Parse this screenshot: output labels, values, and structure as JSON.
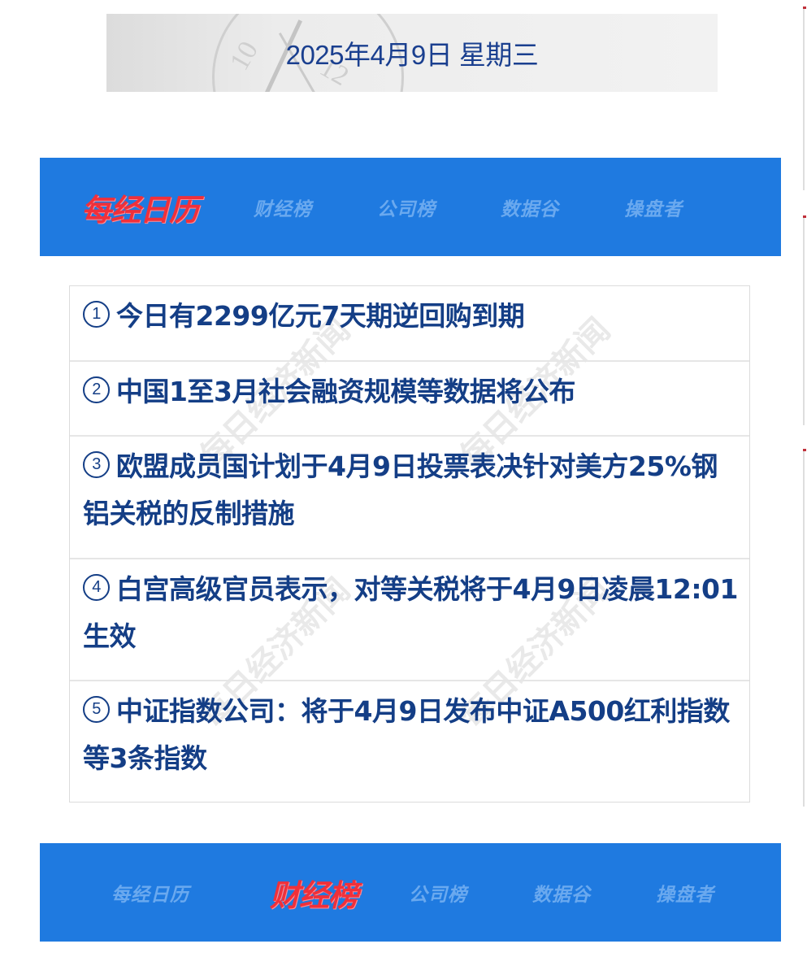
{
  "date_banner": {
    "text": "2025年4月9日   星期三"
  },
  "nav_top": {
    "items": [
      {
        "label": "每经日历",
        "active": true
      },
      {
        "label": "财经榜",
        "active": false
      },
      {
        "label": "公司榜",
        "active": false
      },
      {
        "label": "数据谷",
        "active": false
      },
      {
        "label": "操盘者",
        "active": false
      }
    ]
  },
  "news": {
    "items": [
      {
        "number": "1",
        "text": "今日有2299亿元7天期逆回购到期"
      },
      {
        "number": "2",
        "text": "中国1至3月社会融资规模等数据将公布"
      },
      {
        "number": "3",
        "text": "欧盟成员国计划于4月9日投票表决针对美方25%钢铝关税的反制措施"
      },
      {
        "number": "4",
        "text": "白宫高级官员表示，对等关税将于4月9日凌晨12:01生效"
      },
      {
        "number": "5",
        "text": "中证指数公司：将于4月9日发布中证A500红利指数等3条指数"
      }
    ]
  },
  "nav_bottom": {
    "items": [
      {
        "label": "每经日历",
        "active": false
      },
      {
        "label": "财经榜",
        "active": true
      },
      {
        "label": "公司榜",
        "active": false
      },
      {
        "label": "数据谷",
        "active": false
      },
      {
        "label": "操盘者",
        "active": false
      }
    ]
  },
  "colors": {
    "nav_bg": "#1f7ae0",
    "nav_inactive": "#6aa9ef",
    "nav_active": "#f0303a",
    "news_text": "#143e86",
    "date_text": "#1a3f8f"
  }
}
